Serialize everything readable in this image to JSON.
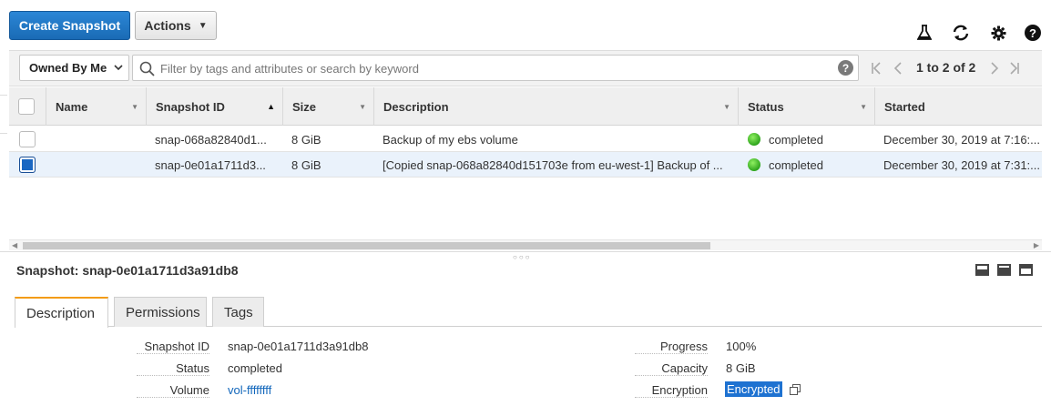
{
  "toolbar": {
    "create_label": "Create Snapshot",
    "actions_label": "Actions",
    "icons": [
      "flask-icon",
      "refresh-icon",
      "gear-icon",
      "help-icon"
    ]
  },
  "filter": {
    "owned_label": "Owned By Me",
    "search_placeholder": "Filter by tags and attributes or search by keyword",
    "pager_text": "1 to 2 of 2"
  },
  "table": {
    "columns": [
      "Name",
      "Snapshot ID",
      "Size",
      "Description",
      "Status",
      "Started"
    ],
    "rows": [
      {
        "name": "",
        "snapshot_id": "snap-068a82840d1...",
        "size": "8 GiB",
        "description": "Backup of my ebs volume",
        "status": "completed",
        "started": "December 30, 2019 at 7:16:...",
        "selected": false
      },
      {
        "name": "",
        "snapshot_id": "snap-0e01a1711d3...",
        "size": "8 GiB",
        "description": "[Copied snap-068a82840d151703e from eu-west-1] Backup of ...",
        "status": "completed",
        "started": "December 30, 2019 at 7:31:...",
        "selected": true
      }
    ]
  },
  "details": {
    "title": "Snapshot: snap-0e01a1711d3a91db8",
    "tabs": [
      "Description",
      "Permissions",
      "Tags"
    ],
    "fields_left": [
      {
        "label": "Snapshot ID",
        "value": "snap-0e01a1711d3a91db8"
      },
      {
        "label": "Status",
        "value": "completed"
      },
      {
        "label": "Volume",
        "value": "vol-ffffffff"
      }
    ],
    "fields_right": [
      {
        "label": "Progress",
        "value": "100%"
      },
      {
        "label": "Capacity",
        "value": "8 GiB"
      },
      {
        "label": "Encryption",
        "value": "Encrypted"
      }
    ]
  },
  "colors": {
    "primary": "#1f78c8",
    "selected_row": "#eaf2fb",
    "status_ok": "#2fa51d",
    "active_tab_accent": "#f39c12"
  }
}
